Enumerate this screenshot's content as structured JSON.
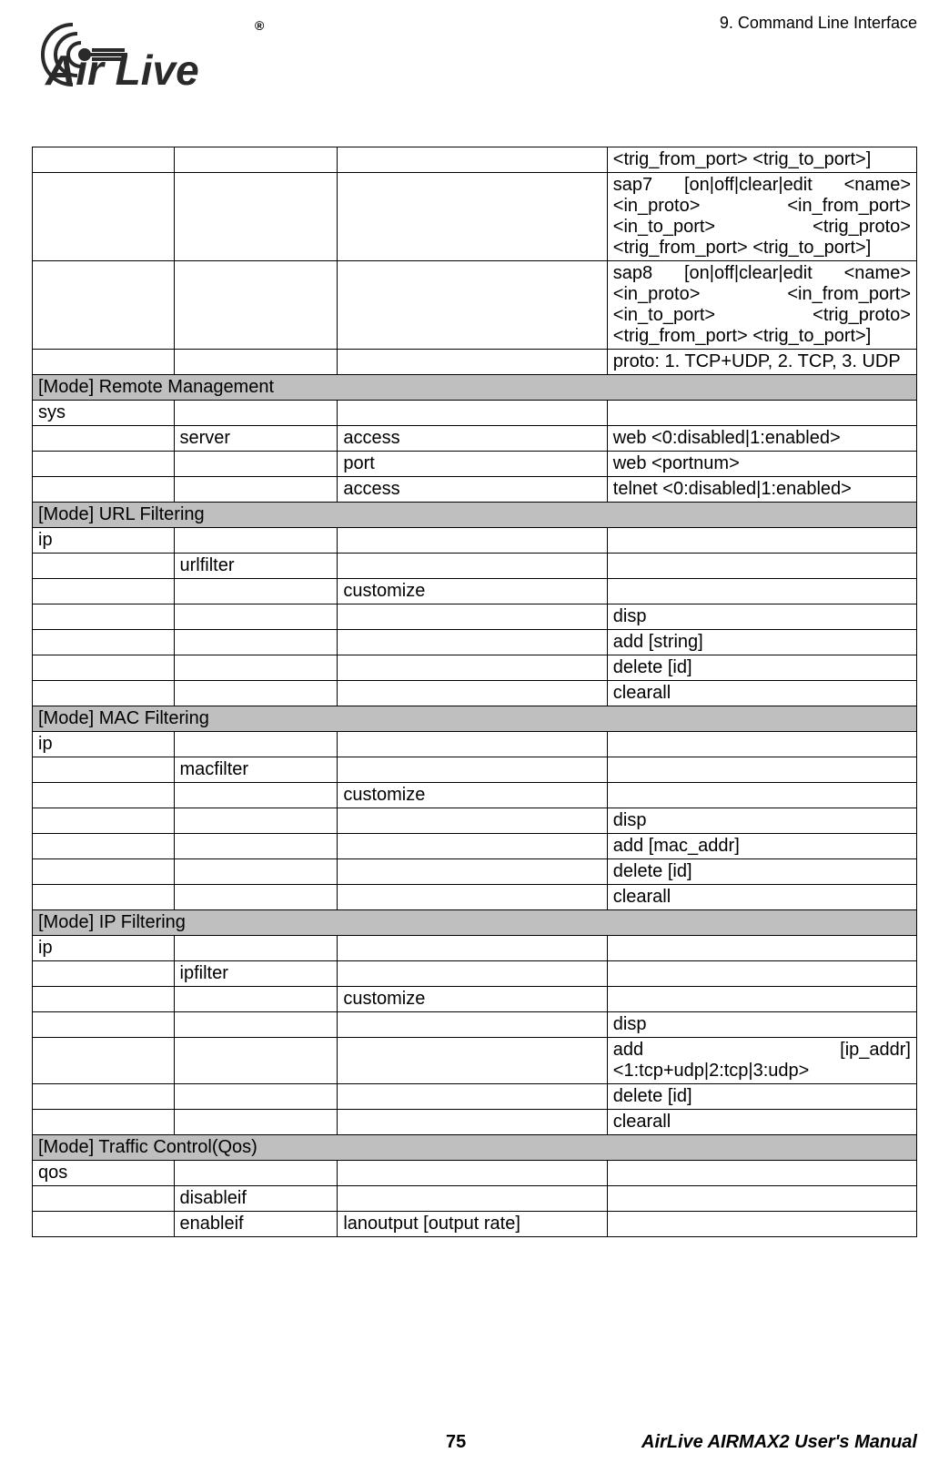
{
  "chapter": "9. Command Line Interface",
  "logo_text": "Air Live",
  "reg_mark": "®",
  "rows": [
    {
      "cells": [
        "",
        "",
        "",
        "<trig_from_port> <trig_to_port>]"
      ]
    },
    {
      "cells": [
        "",
        "",
        "",
        "sap7 [on|off|clear|edit <name> <in_proto> <in_from_port> <in_to_port> <trig_proto> <trig_from_port> <trig_to_port>]"
      ],
      "justify4": true
    },
    {
      "cells": [
        "",
        "",
        "",
        "sap8 [on|off|clear|edit <name> <in_proto> <in_from_port> <in_to_port> <trig_proto> <trig_from_port> <trig_to_port>]"
      ],
      "justify4": true
    },
    {
      "cells": [
        "",
        "",
        "",
        "proto: 1. TCP+UDP, 2. TCP, 3. UDP"
      ]
    },
    {
      "section": "[Mode]  Remote Management"
    },
    {
      "cells": [
        "sys",
        "",
        "",
        ""
      ]
    },
    {
      "cells": [
        "",
        "server",
        "access",
        "web <0:disabled|1:enabled>"
      ]
    },
    {
      "cells": [
        "",
        "",
        "port",
        "web <portnum>"
      ]
    },
    {
      "cells": [
        "",
        "",
        "access",
        "telnet <0:disabled|1:enabled>"
      ]
    },
    {
      "section": "[Mode]  URL Filtering"
    },
    {
      "cells": [
        "ip",
        "",
        "",
        ""
      ]
    },
    {
      "cells": [
        "",
        "urlfilter",
        "",
        ""
      ]
    },
    {
      "cells": [
        "",
        "",
        "customize",
        ""
      ]
    },
    {
      "cells": [
        "",
        "",
        "",
        "disp"
      ]
    },
    {
      "cells": [
        "",
        "",
        "",
        "add [string]"
      ]
    },
    {
      "cells": [
        "",
        "",
        "",
        "delete [id]"
      ]
    },
    {
      "cells": [
        "",
        "",
        "",
        "clearall"
      ]
    },
    {
      "section": "[Mode]  MAC Filtering"
    },
    {
      "cells": [
        "ip",
        "",
        "",
        ""
      ]
    },
    {
      "cells": [
        "",
        "macfilter",
        "",
        ""
      ]
    },
    {
      "cells": [
        "",
        "",
        "customize",
        ""
      ]
    },
    {
      "cells": [
        "",
        "",
        "",
        "disp"
      ]
    },
    {
      "cells": [
        "",
        "",
        "",
        "add [mac_addr]"
      ]
    },
    {
      "cells": [
        "",
        "",
        "",
        "delete [id]"
      ]
    },
    {
      "cells": [
        "",
        "",
        "",
        "clearall"
      ]
    },
    {
      "section": "[Mode]  IP Filtering"
    },
    {
      "cells": [
        "ip",
        "",
        "",
        ""
      ]
    },
    {
      "cells": [
        "",
        "ipfilter",
        "",
        ""
      ]
    },
    {
      "cells": [
        "",
        "",
        "customize",
        ""
      ]
    },
    {
      "cells": [
        "",
        "",
        "",
        "disp"
      ]
    },
    {
      "cells": [
        "",
        "",
        "",
        "add [ip_addr] <1:tcp+udp|2:tcp|3:udp>"
      ],
      "justify4": true
    },
    {
      "cells": [
        "",
        "",
        "",
        "delete [id]"
      ]
    },
    {
      "cells": [
        "",
        "",
        "",
        "clearall"
      ]
    },
    {
      "section": "[Mode]  Traffic Control(Qos)"
    },
    {
      "cells": [
        "qos",
        "",
        "",
        ""
      ]
    },
    {
      "cells": [
        "",
        "disableif",
        "",
        ""
      ]
    },
    {
      "cells": [
        "",
        "enableif",
        "lanoutput [output rate]",
        ""
      ]
    }
  ],
  "page_num": "75",
  "manual": "AirLive AIRMAX2 User's Manual"
}
